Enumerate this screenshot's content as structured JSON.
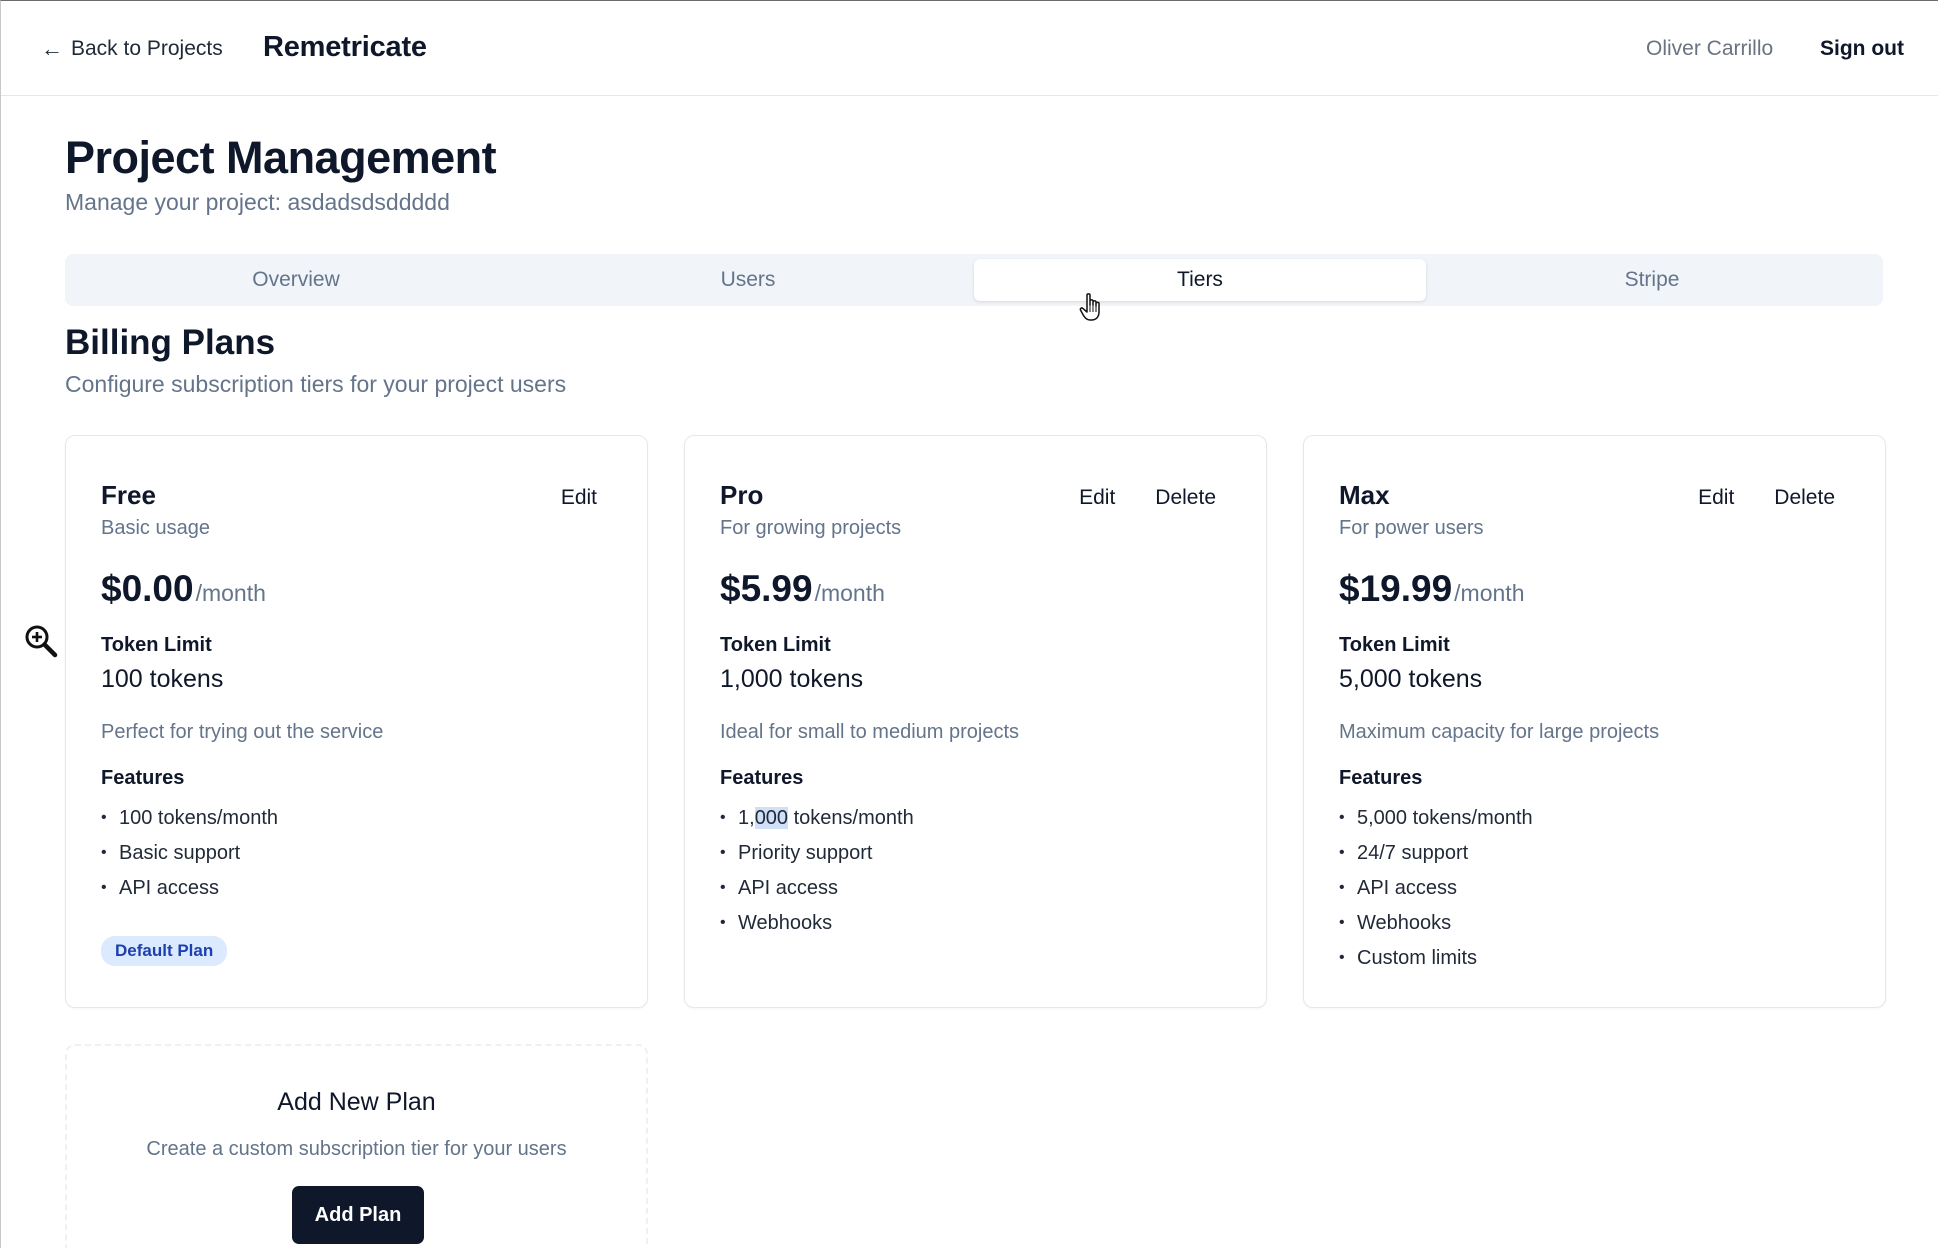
{
  "header": {
    "back_label": "Back to Projects",
    "brand": "Remetricate",
    "user_name": "Oliver Carrillo",
    "sign_out": "Sign out"
  },
  "page": {
    "title": "Project Management",
    "subtitle": "Manage your project: asdadsdsddddd"
  },
  "tabs": [
    {
      "label": "Overview",
      "active": false
    },
    {
      "label": "Users",
      "active": false
    },
    {
      "label": "Tiers",
      "active": true
    },
    {
      "label": "Stripe",
      "active": false
    }
  ],
  "section": {
    "title": "Billing Plans",
    "description": "Configure subscription tiers for your project users"
  },
  "plans": [
    {
      "name": "Free",
      "tagline": "Basic usage",
      "price": "$0.00",
      "period": "/month",
      "token_limit_label": "Token Limit",
      "token_limit": "100 tokens",
      "description": "Perfect for trying out the service",
      "features_label": "Features",
      "features": [
        "100 tokens/month",
        "Basic support",
        "API access"
      ],
      "edit_label": "Edit",
      "badge": "Default Plan"
    },
    {
      "name": "Pro",
      "tagline": "For growing projects",
      "price": "$5.99",
      "period": "/month",
      "token_limit_label": "Token Limit",
      "token_limit": "1,000 tokens",
      "description": "Ideal for small to medium projects",
      "features_label": "Features",
      "features": [
        "1,000 tokens/month",
        "Priority support",
        "API access",
        "Webhooks"
      ],
      "feature_highlight": {
        "prefix": "1,",
        "highlighted": "000",
        "suffix": " tokens/month"
      },
      "edit_label": "Edit",
      "delete_label": "Delete"
    },
    {
      "name": "Max",
      "tagline": "For power users",
      "price": "$19.99",
      "period": "/month",
      "token_limit_label": "Token Limit",
      "token_limit": "5,000 tokens",
      "description": "Maximum capacity for large projects",
      "features_label": "Features",
      "features": [
        "5,000 tokens/month",
        "24/7 support",
        "API access",
        "Webhooks",
        "Custom limits"
      ],
      "edit_label": "Edit",
      "delete_label": "Delete"
    }
  ],
  "add_plan": {
    "title": "Add New Plan",
    "subtitle": "Create a custom subscription tier for your users",
    "button": "Add Plan"
  },
  "icons": {
    "back": "arrow-left-icon",
    "zoom": "zoom-in-icon",
    "cursor": "hand-pointer-cursor"
  }
}
